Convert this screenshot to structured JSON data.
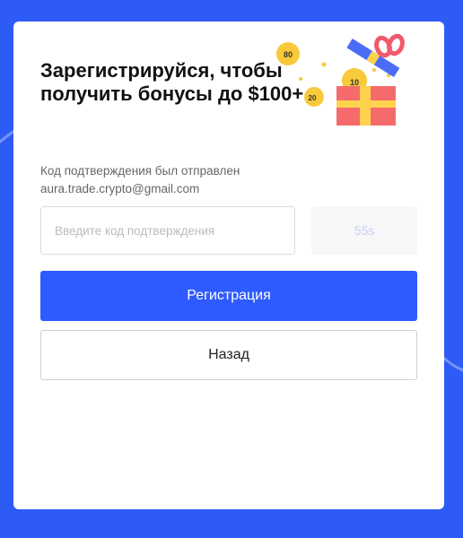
{
  "header": {
    "title": "Зарегистрируйся, чтобы получить бонусы до $100+"
  },
  "illustration": {
    "icon": "gift-box-with-coins-icon",
    "coins": [
      "80",
      "10",
      "20"
    ],
    "colors": {
      "box": "#f56b6b",
      "ribbon": "#ffd24d",
      "lid": "#4a6cf7",
      "bow": "#f05a6c",
      "coin": "#f8c93a"
    }
  },
  "verification": {
    "sent_label": "Код подтверждения был отправлен",
    "email": "aura.trade.crypto@gmail.com",
    "code_placeholder": "Введите код подтверждения",
    "code_value": "",
    "resend_countdown": "55s"
  },
  "actions": {
    "register_label": "Регистрация",
    "back_label": "Назад"
  },
  "colors": {
    "background": "#2e5bf5",
    "primary": "#2e5bff"
  }
}
